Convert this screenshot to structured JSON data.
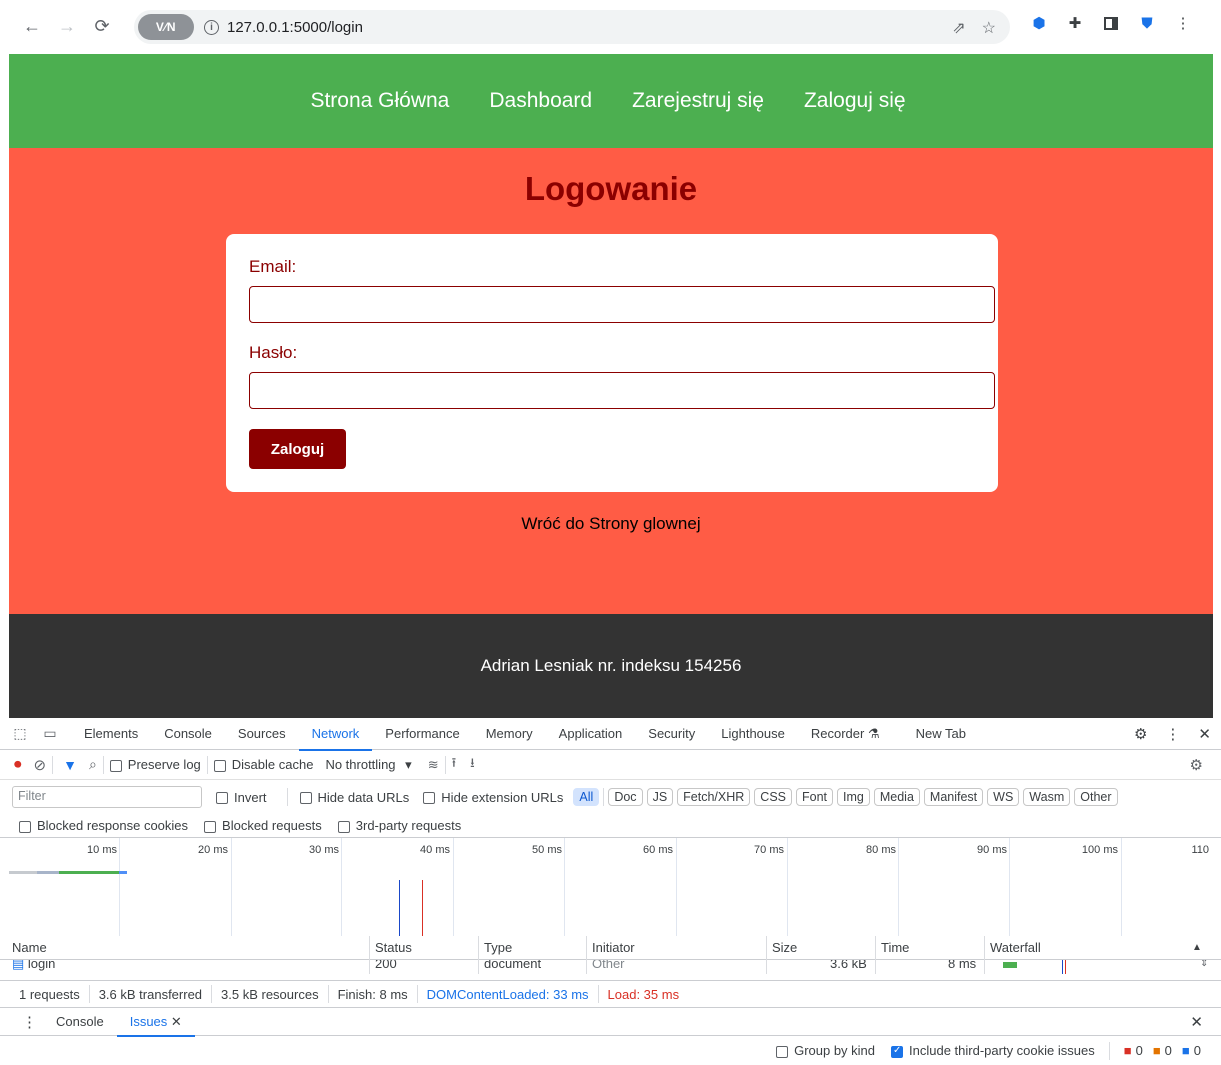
{
  "browser": {
    "url": "127.0.0.1:5000/login",
    "vpn_label": "V⁄N",
    "info_glyph": "i"
  },
  "site": {
    "nav": [
      "Strona Główna",
      "Dashboard",
      "Zarejestruj się",
      "Zaloguj się"
    ],
    "title": "Logowanie",
    "email_label": "Email:",
    "password_label": "Hasło:",
    "submit_label": "Zaloguj",
    "back_link": "Wróć do Strony glownej",
    "footer": "Adrian Lesniak nr. indeksu 154256",
    "colors": {
      "nav": "#4caf50",
      "main": "#ff5c45",
      "accent": "#8b0000",
      "footer": "#333333"
    }
  },
  "devtools": {
    "tabs": [
      "Elements",
      "Console",
      "Sources",
      "Network",
      "Performance",
      "Memory",
      "Application",
      "Security",
      "Lighthouse",
      "Recorder",
      "New Tab"
    ],
    "active_tab": "Network",
    "toolbar": {
      "preserve_log": "Preserve log",
      "disable_cache": "Disable cache",
      "throttling": "No throttling"
    },
    "filter_placeholder": "Filter",
    "filter_options": [
      "Invert",
      "Hide data URLs",
      "Hide extension URLs"
    ],
    "type_chips": [
      "All",
      "Doc",
      "JS",
      "Fetch/XHR",
      "CSS",
      "Font",
      "Img",
      "Media",
      "Manifest",
      "WS",
      "Wasm",
      "Other"
    ],
    "block_options": [
      "Blocked response cookies",
      "Blocked requests",
      "3rd-party requests"
    ],
    "timeline_labels": [
      "10 ms",
      "20 ms",
      "30 ms",
      "40 ms",
      "50 ms",
      "60 ms",
      "70 ms",
      "80 ms",
      "90 ms",
      "100 ms",
      "110"
    ],
    "columns": [
      "Name",
      "Status",
      "Type",
      "Initiator",
      "Size",
      "Time",
      "Waterfall"
    ],
    "rows": [
      {
        "name": "login",
        "status": "200",
        "type": "document",
        "initiator": "Other",
        "size": "3.6 kB",
        "time": "8 ms"
      }
    ],
    "status": {
      "requests": "1 requests",
      "transferred": "3.6 kB transferred",
      "resources": "3.5 kB resources",
      "finish": "Finish: 8 ms",
      "dom_loaded": "DOMContentLoaded: 33 ms",
      "load": "Load: 35 ms"
    },
    "drawer": {
      "tabs": [
        "Console",
        "Issues"
      ],
      "active": "Issues",
      "group_by_kind": "Group by kind",
      "include_third_party": "Include third-party cookie issues",
      "counts": [
        "0",
        "0",
        "0"
      ]
    }
  }
}
